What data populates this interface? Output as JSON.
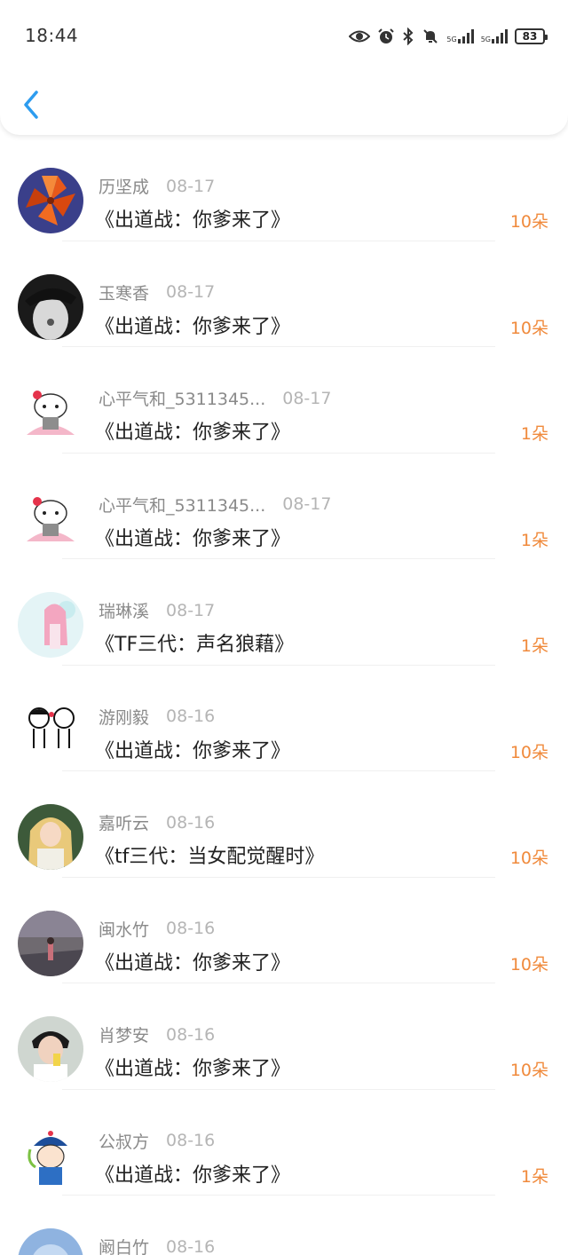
{
  "status_bar": {
    "time": "18:44",
    "signal1": "5G",
    "signal2": "5G",
    "battery": "83"
  },
  "colors": {
    "accent": "#2d9cef",
    "amount": "#f08a3c"
  },
  "rows": [
    {
      "user": "历坚成",
      "date": "08-17",
      "book": "《出道战：你爹来了》",
      "amount": "10朵"
    },
    {
      "user": "玉寒香",
      "date": "08-17",
      "book": "《出道战：你爹来了》",
      "amount": "10朵"
    },
    {
      "user": "心平气和_5311345...",
      "date": "08-17",
      "book": "《出道战：你爹来了》",
      "amount": "1朵"
    },
    {
      "user": "心平气和_5311345...",
      "date": "08-17",
      "book": "《出道战：你爹来了》",
      "amount": "1朵"
    },
    {
      "user": "瑞琳溪",
      "date": "08-17",
      "book": "《TF三代：声名狼藉》",
      "amount": "1朵"
    },
    {
      "user": "游刚毅",
      "date": "08-16",
      "book": "《出道战：你爹来了》",
      "amount": "10朵"
    },
    {
      "user": "嘉听云",
      "date": "08-16",
      "book": "《tf三代：当女配觉醒时》",
      "amount": "10朵"
    },
    {
      "user": "闽水竹",
      "date": "08-16",
      "book": "《出道战：你爹来了》",
      "amount": "10朵"
    },
    {
      "user": "肖梦安",
      "date": "08-16",
      "book": "《出道战：你爹来了》",
      "amount": "10朵"
    },
    {
      "user": "公叔方",
      "date": "08-16",
      "book": "《出道战：你爹来了》",
      "amount": "1朵"
    },
    {
      "user": "阚白竹",
      "date": "08-16",
      "book": "",
      "amount": ""
    }
  ]
}
